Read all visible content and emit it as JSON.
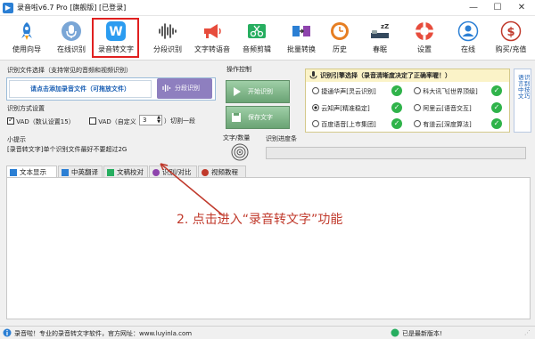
{
  "window": {
    "title": "录音啦v6.7 Pro [旗舰版] [已登录]",
    "minimize": "—",
    "maximize": "☐",
    "close": "✕"
  },
  "toolbar": {
    "items": [
      {
        "label": "使用向导",
        "icon": "rocket-icon"
      },
      {
        "label": "在线识别",
        "icon": "microphone-icon"
      },
      {
        "label": "录音转文字",
        "icon": "w-logo-icon"
      },
      {
        "label": "分段识别",
        "icon": "waveform-icon"
      },
      {
        "label": "文字转语音",
        "icon": "megaphone-icon"
      },
      {
        "label": "音频剪辑",
        "icon": "scissors-icon"
      },
      {
        "label": "批量转换",
        "icon": "convert-icon"
      },
      {
        "label": "历史",
        "icon": "clock-icon"
      },
      {
        "label": "春眠",
        "icon": "sleep-icon"
      },
      {
        "label": "设置",
        "icon": "lifebuoy-icon"
      },
      {
        "label": "在线",
        "icon": "person-icon"
      },
      {
        "label": "购买/充值",
        "icon": "dollar-icon"
      }
    ],
    "selected_index": 2
  },
  "file_select": {
    "title": "识别文件选择（支持常见的音频和视频识别）",
    "add_button": "请点击添加录音文件（可拖放文件）",
    "segment_button": "分段识别"
  },
  "recognition_method": {
    "title": "识别方式设置",
    "option1": "VAD（数认设置15）",
    "option1_checked": true,
    "option2": "VAD（自定义",
    "option2_checked": false,
    "spinner_value": "3",
    "suffix": "）切割一段"
  },
  "tip": {
    "title": "小提示",
    "text": "[录音转文字]单个识别文件最好不要超过2G"
  },
  "operation": {
    "title": "操作控制",
    "start_button": "开始识别",
    "save_button": "保存文字"
  },
  "engine": {
    "title": "识别引擎选择（录音清晰度决定了正确率喔！）",
    "options": [
      {
        "label": "捷通华声[灵云识别]",
        "selected": false
      },
      {
        "label": "科大讯飞[世界顶级]",
        "selected": false
      },
      {
        "label": "云知声[精准稳定]",
        "selected": true
      },
      {
        "label": "阿里云[语音交互]",
        "selected": false
      },
      {
        "label": "百度语音[上市集团]",
        "selected": false
      },
      {
        "label": "有道云[深度算法]",
        "selected": false
      }
    ],
    "side_labels": [
      "语言：中文",
      "识别技巧"
    ]
  },
  "text_count": {
    "label": "文字/数量"
  },
  "progress": {
    "label": "识别进度条",
    "value": 0
  },
  "tabs": [
    {
      "label": "文本显示",
      "active": true,
      "icon": "text-icon"
    },
    {
      "label": "中英翻译",
      "active": false,
      "icon": "translate-icon"
    },
    {
      "label": "文稿校对",
      "active": false,
      "icon": "proofread-icon"
    },
    {
      "label": "识别/对比",
      "active": false,
      "icon": "compare-icon"
    },
    {
      "label": "视频教程",
      "active": false,
      "icon": "video-icon"
    }
  ],
  "annotation": {
    "text": "2. 点击进入“录音转文字”功能"
  },
  "status": {
    "left": "录音啦！专业的录音转文字软件，官方网址：www.luyinla.com",
    "right": "已是最新版本!"
  },
  "colors": {
    "accent_blue": "#2b7fd4",
    "highlight_red": "#e02020",
    "annotation_red": "#c0392b",
    "check_green": "#2fb34a",
    "segment_purple": "#8e7fbf"
  }
}
